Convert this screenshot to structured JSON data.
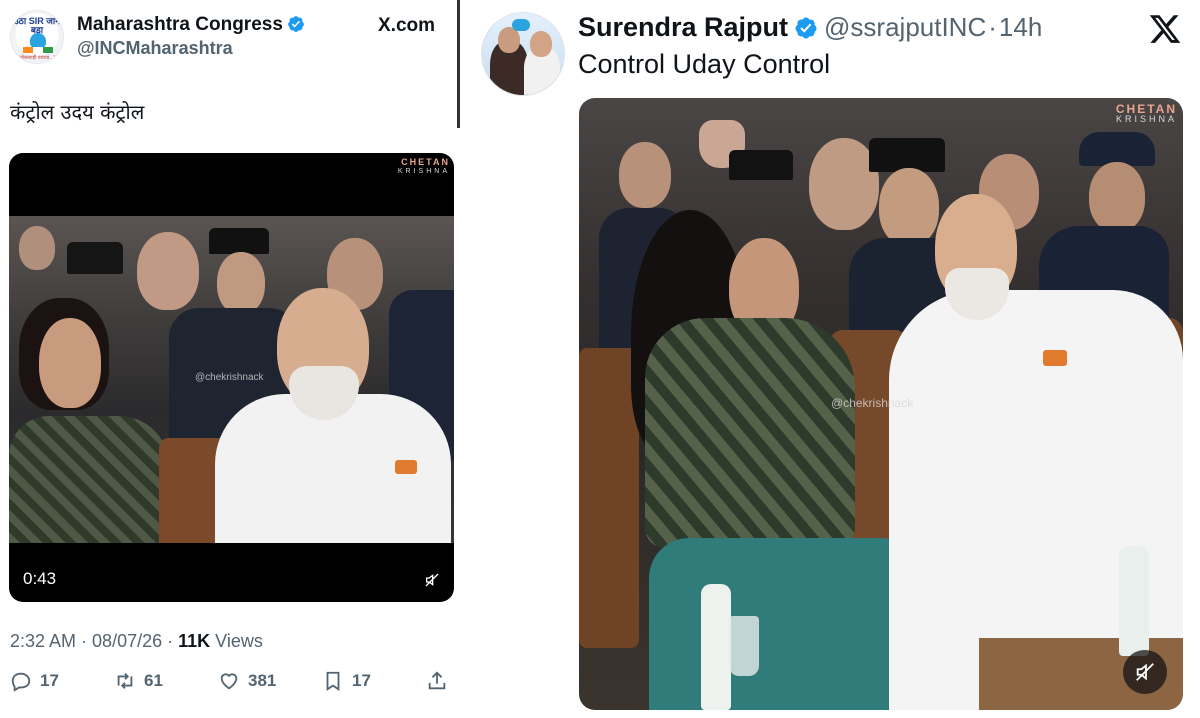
{
  "left_tweet": {
    "avatar": {
      "line1": "उठा SIR जाने बड़ा",
      "sub": "लोकशाही वाचवा...!"
    },
    "author_name": "Maharashtra Congress",
    "handle": "@INCMaharashtra",
    "source": "X.com",
    "text": "कंट्रोल उदय कंट्रोल",
    "video": {
      "duration": "0:43",
      "watermark_top": "CHETAN",
      "watermark_top_sub": "KRISHNA",
      "watermark_mid": "@chekrishnack"
    },
    "time": "2:32 AM",
    "date": "08/07/26",
    "views_count": "11K",
    "views_label": "Views",
    "actions": {
      "replies": "17",
      "reposts": "61",
      "likes": "381",
      "bookmarks": "17"
    }
  },
  "right_tweet": {
    "author_name": "Surendra Rajput",
    "handle": "@ssrajputINC",
    "age": "14h",
    "text": "Control Uday Control",
    "media": {
      "watermark_top": "CHETAN",
      "watermark_top_sub": "KRISHNA",
      "watermark_mid": "@chekrishnack"
    }
  },
  "colors": {
    "verified": "#1d9bf0",
    "muted_text": "#536471",
    "text": "#0f1419",
    "divider": "#2f3336"
  },
  "icons": [
    "verified-badge-icon",
    "x-logo-icon",
    "reply-icon",
    "repost-icon",
    "like-icon",
    "bookmark-icon",
    "share-icon",
    "mute-icon"
  ]
}
